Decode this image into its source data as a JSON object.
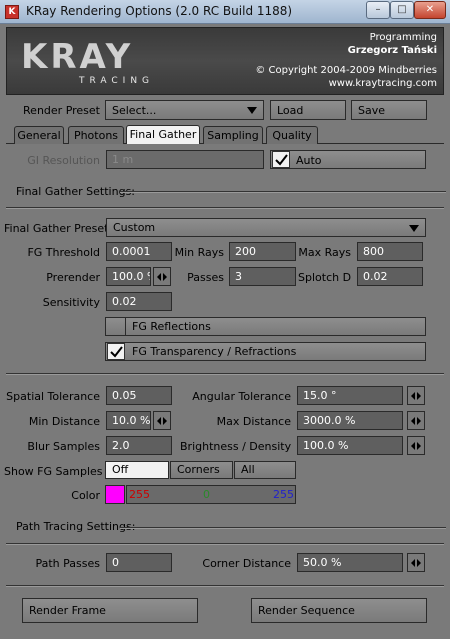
{
  "window": {
    "title": "KRay Rendering Options (2.0 RC Build 1188)",
    "app_icon_glyph": "K",
    "min_glyph": "–",
    "max_glyph": "□",
    "close_glyph": "✕"
  },
  "banner": {
    "line1": "Programming",
    "line2": "Grzegorz Tański",
    "line3": "© Copyright 2004-2009 Mindberries",
    "line4": "www.kraytracing.com",
    "logo_text": "KRAY",
    "logo_sub": "TRACING"
  },
  "preset": {
    "label": "Render Preset",
    "value": "Select...",
    "load": "Load",
    "save": "Save"
  },
  "tabs": [
    "General",
    "Photons",
    "Final Gather",
    "Sampling",
    "Quality"
  ],
  "active_tab": "Final Gather",
  "gi": {
    "label": "GI Resolution",
    "value": "1 m",
    "auto_label": "Auto",
    "auto_checked": true
  },
  "fg_settings": {
    "heading": "Final Gather Settings:",
    "preset_label": "Final Gather Preset",
    "preset_value": "Custom",
    "threshold_label": "FG Threshold",
    "threshold": "0.0001",
    "min_rays_label": "Min Rays",
    "min_rays": "200",
    "max_rays_label": "Max Rays",
    "max_rays": "800",
    "prerender_label": "Prerender",
    "prerender": "100.0 %",
    "passes_label": "Passes",
    "passes": "3",
    "splotch_label": "Splotch D",
    "splotch": "0.02",
    "sensitivity_label": "Sensitivity",
    "sensitivity": "0.02",
    "reflections_label": "FG Reflections",
    "reflections_checked": false,
    "transparency_label": "FG Transparency / Refractions",
    "transparency_checked": true
  },
  "tolerance": {
    "spatial_label": "Spatial Tolerance",
    "spatial": "0.05",
    "angular_label": "Angular Tolerance",
    "angular": "15.0 °",
    "min_dist_label": "Min Distance",
    "min_dist": "10.0 %",
    "max_dist_label": "Max Distance",
    "max_dist": "3000.0 %",
    "blur_label": "Blur Samples",
    "blur": "2.0",
    "brightness_label": "Brightness / Density",
    "brightness": "100.0 %",
    "show_samples_label": "Show FG Samples",
    "show_options": [
      "Off",
      "Corners",
      "All"
    ],
    "show_selected": "Off",
    "color_label": "Color",
    "color_hex": "#ff00ff",
    "color_r": "255",
    "color_g": "0",
    "color_b": "255",
    "color_r_hex": "#cc0000",
    "color_g_hex": "#2a8a2a",
    "color_b_hex": "#2222cc"
  },
  "path_tracing": {
    "heading": "Path Tracing Settings:",
    "passes_label": "Path Passes",
    "passes": "0",
    "corner_label": "Corner Distance",
    "corner": "50.0 %"
  },
  "footer": {
    "render_frame": "Render Frame",
    "render_sequence": "Render Sequence"
  }
}
